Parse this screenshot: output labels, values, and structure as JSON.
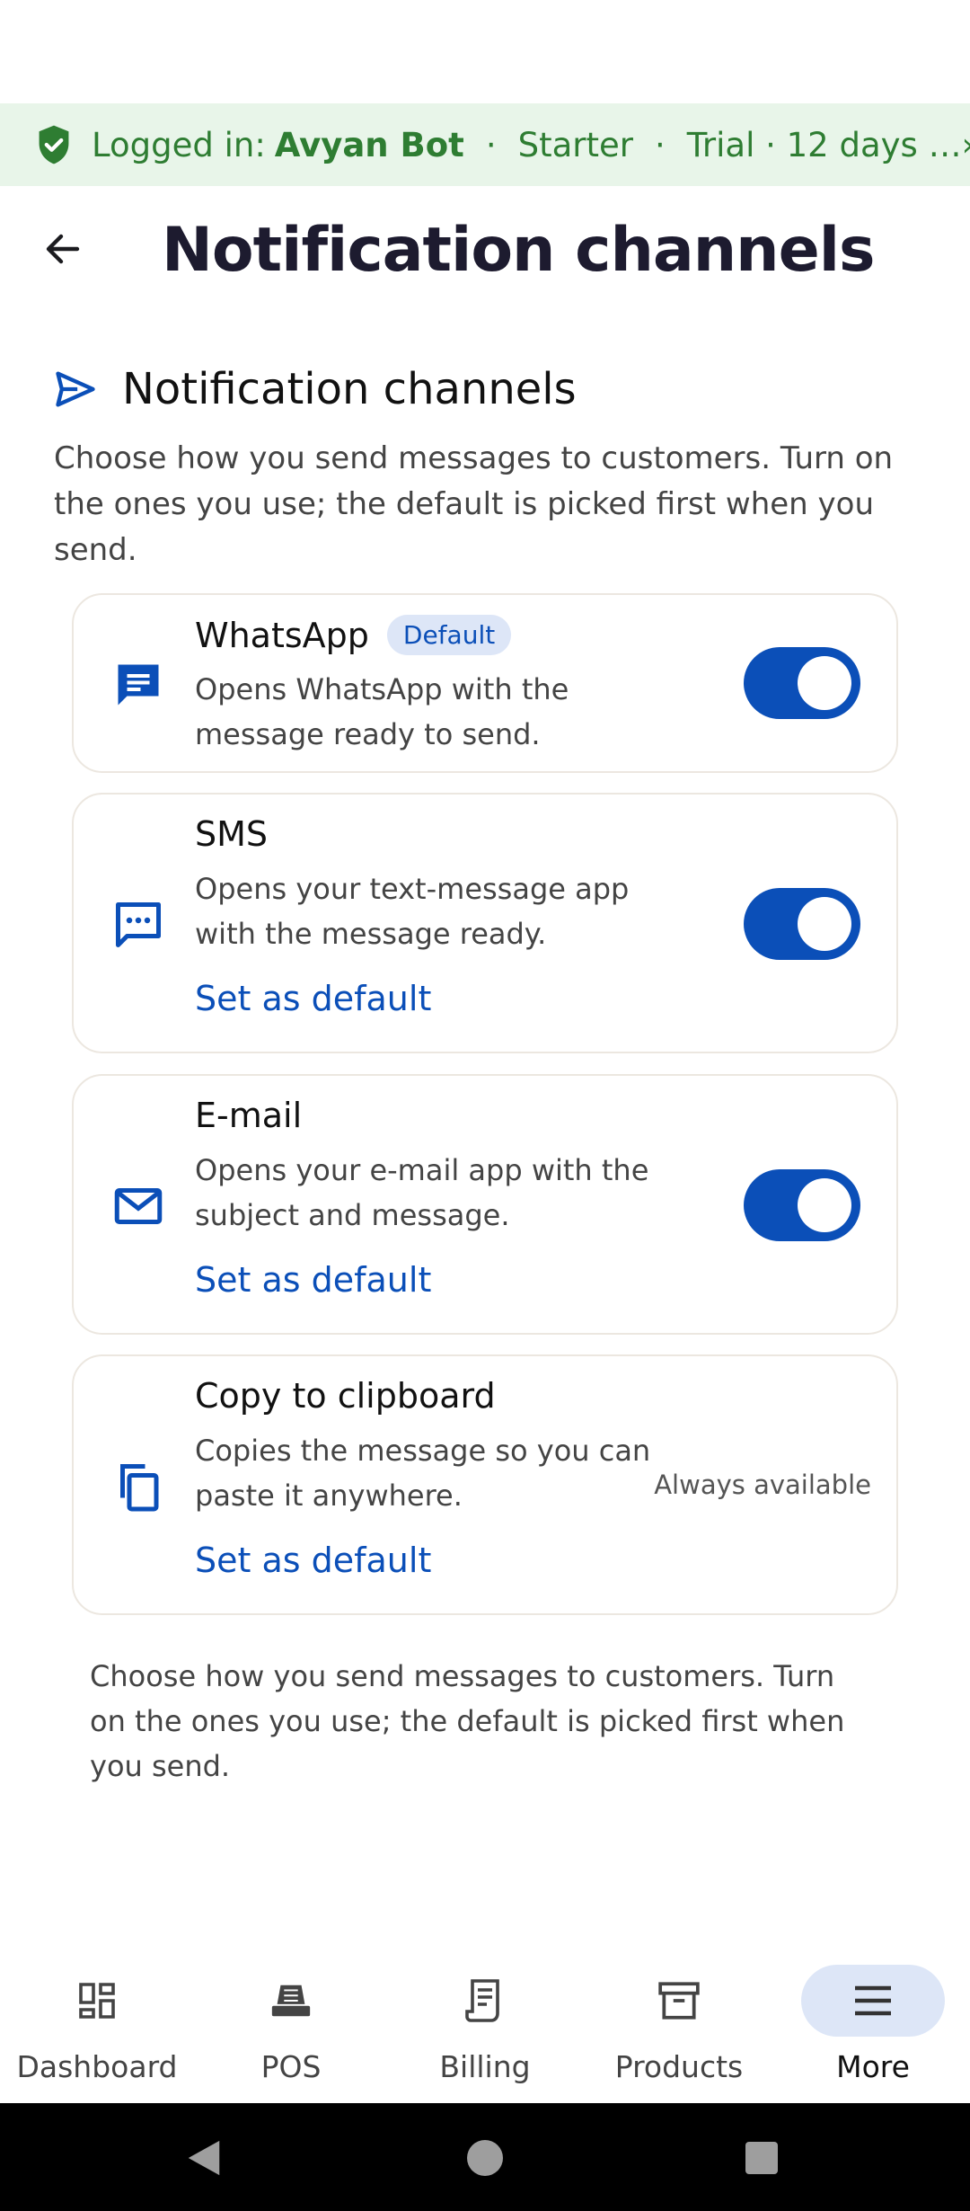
{
  "banner": {
    "prefix": "Logged in:",
    "user": "Avyan Bot",
    "plan": "Starter",
    "trial": "Trial · 12 days …",
    "separator": "·",
    "chevron": "›"
  },
  "app_bar": {
    "title": "Notification channels"
  },
  "section": {
    "title": "Notification channels",
    "description": "Choose how you send messages to customers. Turn on the ones you use; the default is picked first when you send."
  },
  "channels": [
    {
      "name": "WhatsApp",
      "badge": "Default",
      "description": "Opens WhatsApp with the message ready to send.",
      "enabled": true,
      "icon": "chat-icon"
    },
    {
      "name": "SMS",
      "description": "Opens your text-message app with the message ready.",
      "set_default": "Set as default",
      "enabled": true,
      "icon": "sms-icon"
    },
    {
      "name": "E-mail",
      "description": "Opens your e-mail app with the subject and message.",
      "set_default": "Set as default",
      "enabled": true,
      "icon": "mail-icon"
    },
    {
      "name": "Copy to clipboard",
      "description": "Copies the message so you can paste it anywhere.",
      "set_default": "Set as default",
      "status": "Always available",
      "icon": "copy-icon"
    }
  ],
  "footer_note": "Choose how you send messages to customers. Turn on the ones you use; the default is picked first when you send.",
  "bottom_nav": [
    {
      "label": "Dashboard",
      "icon": "dashboard-icon"
    },
    {
      "label": "POS",
      "icon": "pos-icon"
    },
    {
      "label": "Billing",
      "icon": "billing-icon"
    },
    {
      "label": "Products",
      "icon": "products-icon"
    },
    {
      "label": "More",
      "icon": "menu-icon",
      "active": true
    }
  ],
  "colors": {
    "accent": "#0b4fb8",
    "banner_bg": "#e8f5e9",
    "banner_text": "#2e7d32"
  }
}
